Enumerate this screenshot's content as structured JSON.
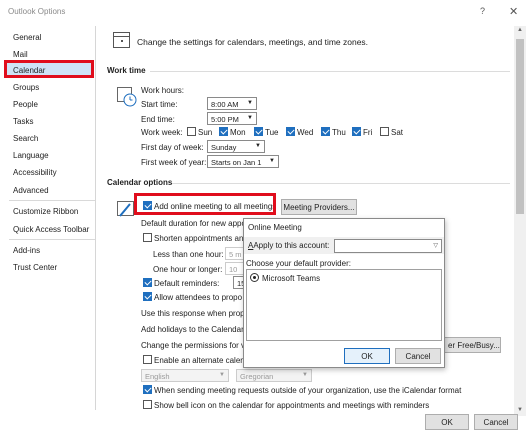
{
  "window": {
    "title": "Outlook Options",
    "help": "?",
    "close": "✕"
  },
  "sidebar": {
    "items": [
      {
        "label": "General"
      },
      {
        "label": "Mail"
      },
      {
        "label": "Calendar"
      },
      {
        "label": "Groups"
      },
      {
        "label": "People"
      },
      {
        "label": "Tasks"
      },
      {
        "label": "Search"
      },
      {
        "label": "Language"
      },
      {
        "label": "Accessibility"
      },
      {
        "label": "Advanced"
      },
      {
        "label": "Customize Ribbon"
      },
      {
        "label": "Quick Access Toolbar"
      },
      {
        "label": "Add-ins"
      },
      {
        "label": "Trust Center"
      }
    ],
    "selected": "Calendar"
  },
  "header": {
    "text": "Change the settings for calendars, meetings, and time zones."
  },
  "work_time": {
    "heading": "Work time",
    "work_hours": "Work hours:",
    "start_label": "Start time:",
    "start_value": "8:00 AM",
    "end_label": "End time:",
    "end_value": "5:00 PM",
    "week_label": "Work week:",
    "days": [
      {
        "label": "Sun",
        "checked": false
      },
      {
        "label": "Mon",
        "checked": true
      },
      {
        "label": "Tue",
        "checked": true
      },
      {
        "label": "Wed",
        "checked": true
      },
      {
        "label": "Thu",
        "checked": true
      },
      {
        "label": "Fri",
        "checked": true
      },
      {
        "label": "Sat",
        "checked": false
      }
    ],
    "first_day_label": "First day of week:",
    "first_day_value": "Sunday",
    "first_week_label": "First week of year:",
    "first_week_value": "Starts on Jan 1"
  },
  "calendar_options": {
    "heading": "Calendar options",
    "add_online": "Add online meeting to all meetings",
    "providers_button": "Meeting Providers...",
    "default_duration": "Default duration for new appo",
    "shorten": "Shorten appointments and",
    "less_than_hour": "Less than one hour:",
    "less_than_value": "5 m",
    "hour_or_longer": "One hour or longer:",
    "hour_value": "10",
    "default_reminders": "Default reminders:",
    "reminder_value": "15 m",
    "allow_propose": "Allow attendees to propo",
    "use_response": "Use this response when propo",
    "add_holidays": "Add holidays to the Calendar:",
    "change_permissions": "Change the permissions for vi",
    "free_busy_button": "er Free/Busy...",
    "alternate_calendar": "Enable an alternate calend",
    "lang_value": "English",
    "cal_value": "Gregorian",
    "icalendar": "When sending meeting requests outside of your organization, use the iCalendar format",
    "bell_icon": "Show bell icon on the calendar for appointments and meetings with reminders"
  },
  "dialog": {
    "title": "Online Meeting",
    "apply_label": "Apply to this account:",
    "provider_label": "Choose your default provider:",
    "provider_option": "Microsoft Teams",
    "ok": "OK",
    "cancel": "Cancel"
  },
  "footer": {
    "ok": "OK",
    "cancel": "Cancel"
  },
  "colors": {
    "highlight": "#e00d1c",
    "accent": "#1f6fbf",
    "selected_bg": "#cfe3f6"
  }
}
